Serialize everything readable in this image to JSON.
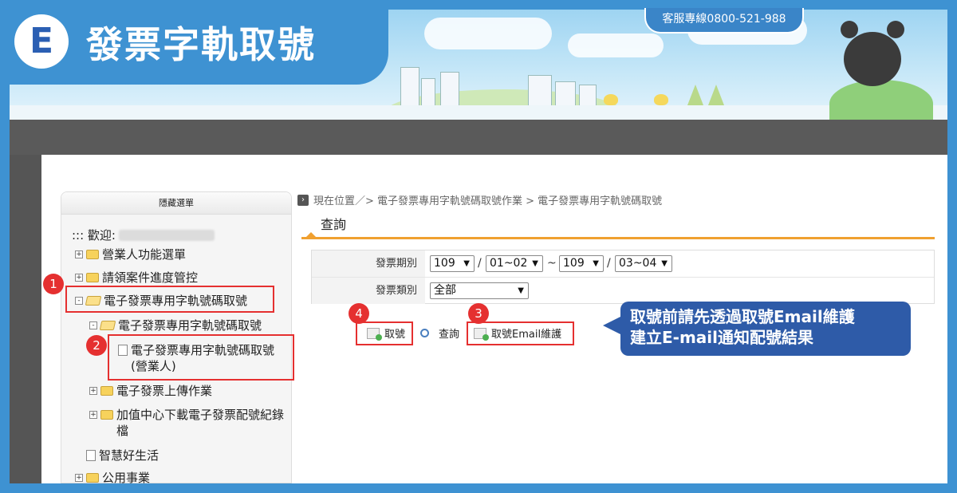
{
  "header": {
    "title": "發票字軌取號",
    "logo_letter": "E",
    "service_line": "客服專線0800-521-988"
  },
  "menu": {
    "toggle_label": "隱藏選單",
    "welcome": "::: 歡迎:",
    "items": [
      {
        "label": "營業人功能選單"
      },
      {
        "label": "請領案件進度管控"
      },
      {
        "label": "電子發票專用字軌號碼取號"
      },
      {
        "label": "電子發票專用字軌號碼取號"
      },
      {
        "label": "電子發票專用字軌號碼取號"
      },
      {
        "label": "(營業人)"
      },
      {
        "label": "電子發票上傳作業"
      },
      {
        "label": "加值中心下載電子發票配號紀錄"
      },
      {
        "label": "檔"
      },
      {
        "label": "智慧好生活"
      },
      {
        "label": "公用事業"
      }
    ]
  },
  "breadcrumb": "現在位置／> 電子發票專用字軌號碼取號作業 > 電子發票專用字軌號碼取號",
  "tab": {
    "label": "查詢"
  },
  "form": {
    "period_label": "發票期別",
    "year_from": "109",
    "month_from": "01~02",
    "tilde": "~",
    "slash": "/",
    "year_to": "109",
    "month_to": "03~04",
    "type_label": "發票類別",
    "type_value": "全部"
  },
  "actions": {
    "take_number": "取號",
    "query": "查詢",
    "email_maintain": "取號Email維護"
  },
  "steps": [
    "1",
    "2",
    "3",
    "4"
  ],
  "callout": {
    "line1": "取號前請先透過取號Email維護",
    "line2": "建立E-mail通知配號結果"
  },
  "colors": {
    "frame_blue": "#3e92d2",
    "highlight_red": "#e53030",
    "callout_blue": "#2e5ba8",
    "tab_orange": "#f0a030"
  }
}
